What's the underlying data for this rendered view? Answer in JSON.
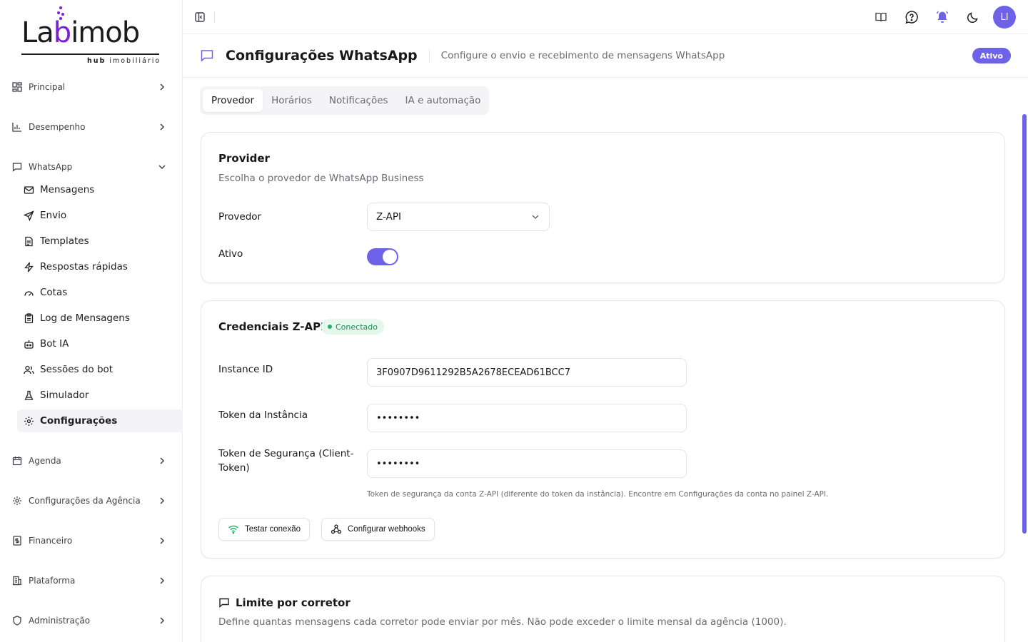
{
  "brand": {
    "logo_plain_1": "La",
    "logo_accent": "b",
    "logo_plain_2": "imob",
    "tagline_bold": "hub",
    "tagline": " imobiliário"
  },
  "sidebar": {
    "groups": {
      "principal": "Principal",
      "desempenho": "Desempenho",
      "whatsapp": "WhatsApp",
      "agenda": "Agenda",
      "config_agencia": "Configurações da Agência",
      "financeiro": "Financeiro",
      "plataforma": "Plataforma",
      "administracao": "Administração"
    },
    "whatsapp_items": {
      "mensagens": "Mensagens",
      "envio": "Envio",
      "templates": "Templates",
      "respostas": "Respostas rápidas",
      "cotas": "Cotas",
      "log": "Log de Mensagens",
      "bot": "Bot IA",
      "sessoes": "Sessões do bot",
      "simulador": "Simulador",
      "configuracoes": "Configurações"
    }
  },
  "topbar": {
    "avatar_initials": "LI"
  },
  "header": {
    "title": "Configurações WhatsApp",
    "subtitle": "Configure o envio e recebimento de mensagens WhatsApp",
    "status": "Ativo"
  },
  "tabs": {
    "provedor": "Provedor",
    "horarios": "Horários",
    "notificacoes": "Notificações",
    "ia": "IA e automação"
  },
  "provider_card": {
    "title": "Provider",
    "description": "Escolha o provedor de WhatsApp Business",
    "provider_label": "Provedor",
    "provider_value": "Z-API",
    "active_label": "Ativo",
    "active_on": true
  },
  "credentials_card": {
    "title": "Credenciais Z-API",
    "status": "Conectado",
    "instance_label": "Instance ID",
    "instance_value": "3F0907D9611292B5A2678ECEAD61BCC7",
    "token_label": "Token da Instância",
    "token_value": "••••••••",
    "security_label": "Token de Segurança (Client-Token)",
    "security_value": "••••••••",
    "hint": "Token de segurança da conta Z-API (diferente do token da instância). Encontre em Configurações da conta no painel Z-API.",
    "test_button": "Testar conexão",
    "webhooks_button": "Configurar webhooks"
  },
  "limit_card": {
    "title": "Limite por corretor",
    "description": "Define quantas mensagens cada corretor pode enviar por mês. Não pode exceder o limite mensal da agência (1000)."
  },
  "colors": {
    "accent": "#6d62e8",
    "brand_purple": "#7c1fd6",
    "success": "#22b35e"
  }
}
